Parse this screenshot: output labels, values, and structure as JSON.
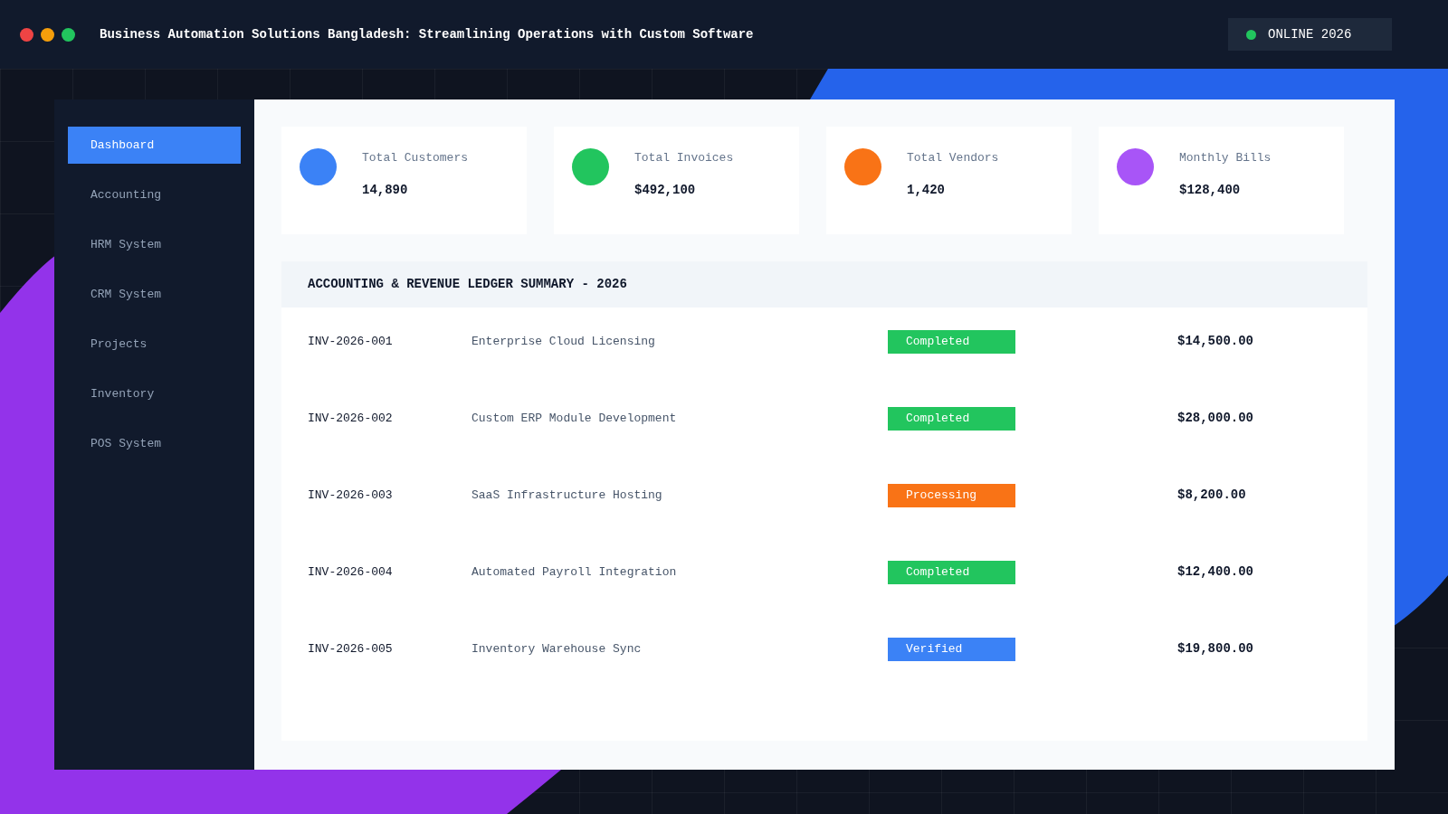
{
  "window": {
    "title": "Business Automation Solutions Bangladesh: Streamlining Operations with Custom Software",
    "status": {
      "label": "ONLINE 2026",
      "color": "#22c55e"
    }
  },
  "sidebar": {
    "items": [
      {
        "label": "Dashboard",
        "selected": true
      },
      {
        "label": "Accounting",
        "selected": false
      },
      {
        "label": "HRM System",
        "selected": false
      },
      {
        "label": "CRM System",
        "selected": false
      },
      {
        "label": "Projects",
        "selected": false
      },
      {
        "label": "Inventory",
        "selected": false
      },
      {
        "label": "POS System",
        "selected": false
      }
    ]
  },
  "stats": [
    {
      "label": "Total Customers",
      "value": "14,890",
      "color": "#3b82f6"
    },
    {
      "label": "Total Invoices",
      "value": "$492,100",
      "color": "#22c55e"
    },
    {
      "label": "Total Vendors",
      "value": "1,420",
      "color": "#f97316"
    },
    {
      "label": "Monthly Bills",
      "value": "$128,400",
      "color": "#a855f7"
    }
  ],
  "ledger": {
    "title": "ACCOUNTING & REVENUE LEDGER SUMMARY - 2026",
    "rows": [
      {
        "id": "INV-2026-001",
        "description": "Enterprise Cloud Licensing",
        "status": "Completed",
        "color": "#22c55e",
        "amount": "$14,500.00"
      },
      {
        "id": "INV-2026-002",
        "description": "Custom ERP Module Development",
        "status": "Completed",
        "color": "#22c55e",
        "amount": "$28,000.00"
      },
      {
        "id": "INV-2026-003",
        "description": "SaaS Infrastructure Hosting",
        "status": "Processing",
        "color": "#f97316",
        "amount": "$8,200.00"
      },
      {
        "id": "INV-2026-004",
        "description": "Automated Payroll Integration",
        "status": "Completed",
        "color": "#22c55e",
        "amount": "$12,400.00"
      },
      {
        "id": "INV-2026-005",
        "description": "Inventory Warehouse Sync",
        "status": "Verified",
        "color": "#3b82f6",
        "amount": "$19,800.00"
      }
    ]
  }
}
